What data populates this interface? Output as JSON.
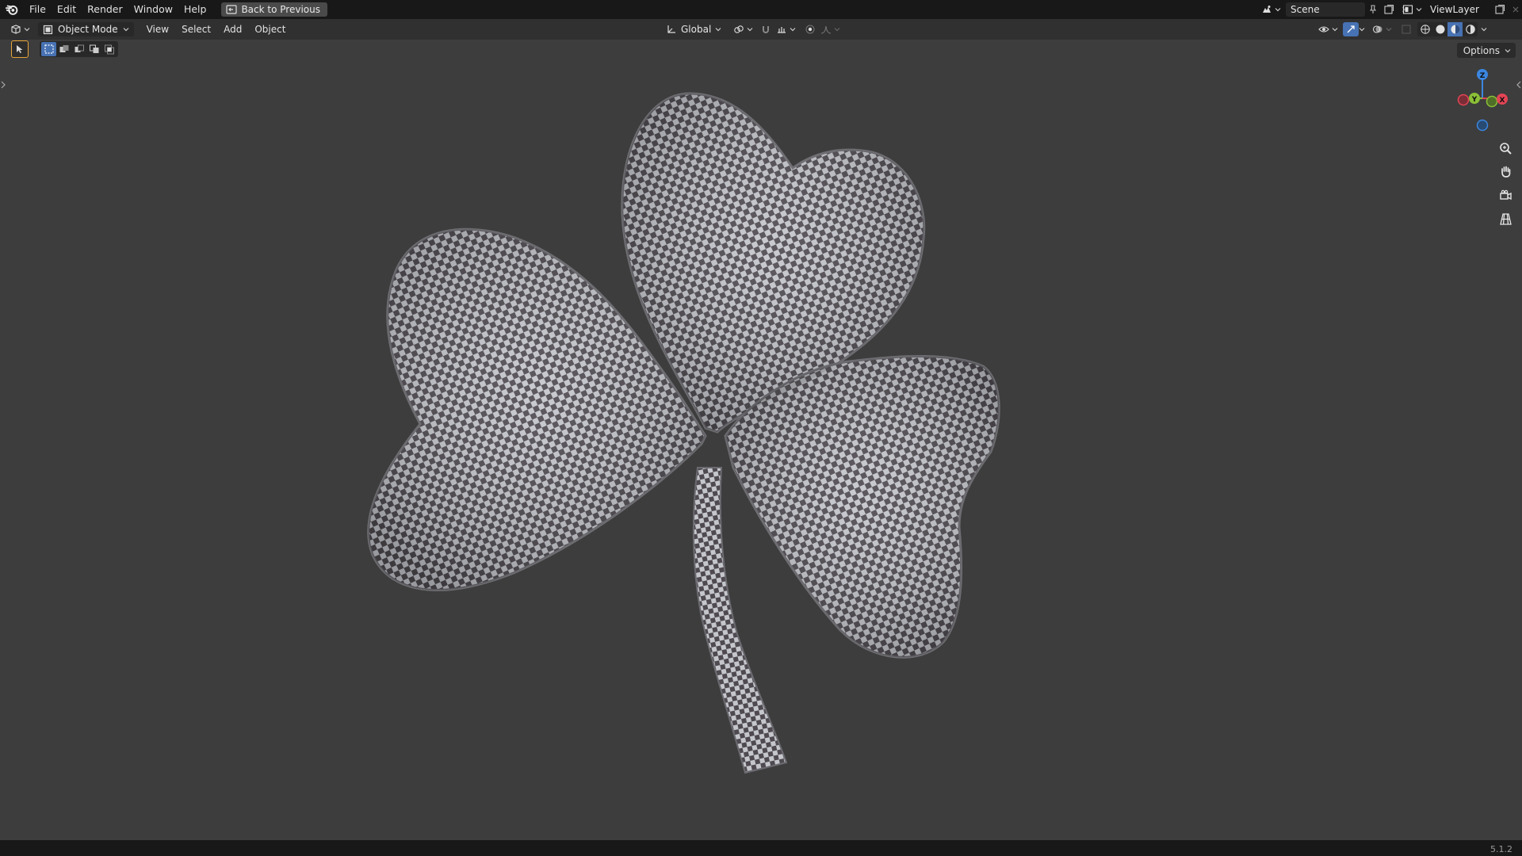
{
  "menu": {
    "items": [
      "File",
      "Edit",
      "Render",
      "Window",
      "Help"
    ],
    "back_to_previous": "Back to Previous"
  },
  "scene": {
    "name": "Scene"
  },
  "view_layer": {
    "name": "ViewLayer"
  },
  "viewport_header": {
    "mode": "Object Mode",
    "menus": [
      "View",
      "Select",
      "Add",
      "Object"
    ],
    "orientation": "Global",
    "shading_active": "solid"
  },
  "options_label": "Options",
  "gizmo": {
    "z": "Z",
    "y": "Y",
    "x": "X"
  },
  "version": "5.1.2",
  "object": {
    "name_icon": "shamrock-mesh",
    "texture": "checker"
  },
  "colors": {
    "accent": "#4772b3",
    "viewport_bg": "#3d3d3d",
    "axis_x": "#e44455",
    "axis_y": "#8bbf37",
    "axis_z": "#3b86e0"
  }
}
